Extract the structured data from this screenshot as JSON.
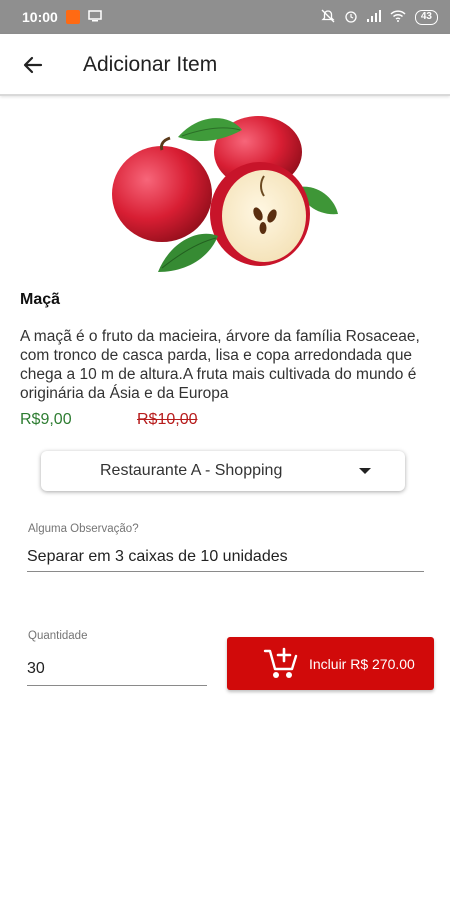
{
  "status_bar": {
    "time": "10:00",
    "battery": "43",
    "icons": [
      "notification-square-icon",
      "screen-icon",
      "mute-icon",
      "alarm-icon",
      "signal-icon",
      "wifi-icon",
      "battery-icon"
    ]
  },
  "app_bar": {
    "title": "Adicionar Item",
    "back_icon": "arrow-back-icon"
  },
  "product": {
    "image": "apple-photo",
    "name": "Maçã",
    "description": "A maçã é o fruto da macieira, árvore da família Rosaceae, com tronco de casca parda, lisa e copa arredondada que chega a 10 m de altura.A fruta mais cultivada do mundo é originária da Ásia e da Europa",
    "price": "R$9,00",
    "old_price": "R$10,00"
  },
  "store_select": {
    "value": "Restaurante A - Shopping"
  },
  "observation": {
    "label": "Alguma Observação?",
    "value": "Separar em 3 caixas de 10 unidades"
  },
  "quantity": {
    "label": "Quantidade",
    "value": "30"
  },
  "add_button": {
    "label": "Incluir R$ 270.00",
    "icon": "add-to-cart-icon"
  },
  "colors": {
    "accent": "#d10a0a",
    "price": "#2e7d32",
    "old_price": "#b71c1c",
    "status_bar": "#8f8f8f"
  }
}
